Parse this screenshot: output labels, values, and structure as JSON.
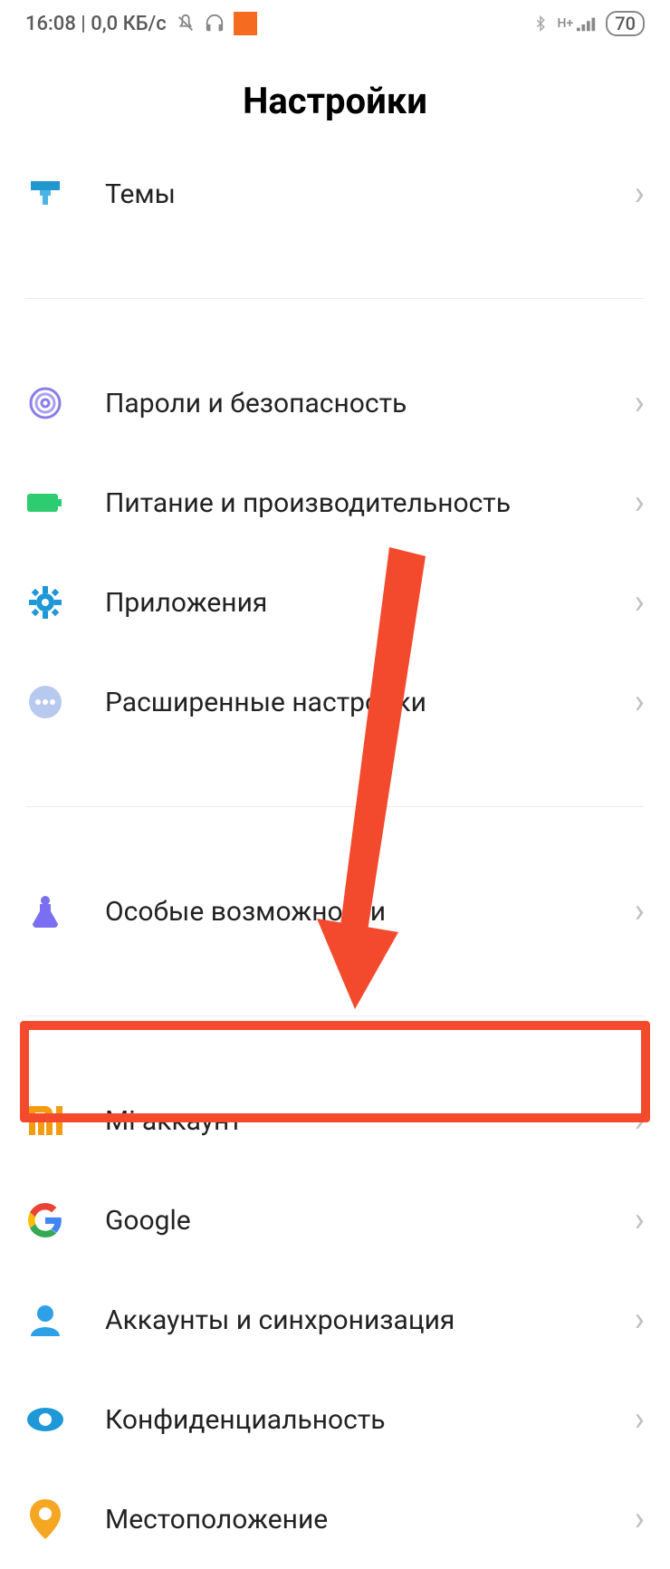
{
  "status": {
    "time": "16:08",
    "net_speed": "0,0 КБ/с",
    "battery": "70"
  },
  "page_title": "Настройки",
  "items": {
    "themes": "Темы",
    "passwords_security": "Пароли и безопасность",
    "battery_perf": "Питание и производительность",
    "apps": "Приложения",
    "advanced": "Расширенные настройки",
    "accessibility": "Особые возможности",
    "mi_account": "Mi аккаунт",
    "google": "Google",
    "accounts_sync": "Аккаунты и синхронизация",
    "privacy": "Конфиденциальность",
    "location": "Местоположение"
  }
}
